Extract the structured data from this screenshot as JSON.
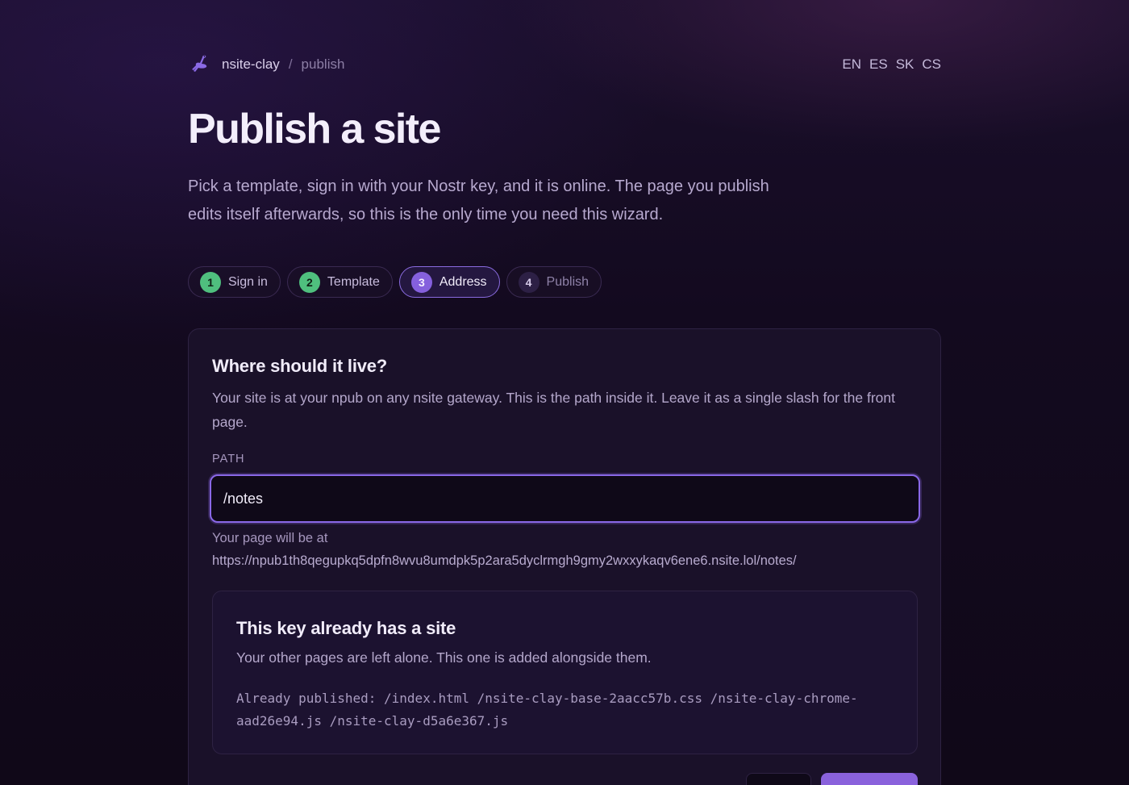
{
  "header": {
    "logo_icon": "ostrich-icon",
    "breadcrumb": {
      "home": "nsite-clay",
      "separator": "/",
      "current": "publish"
    },
    "languages": [
      "EN",
      "ES",
      "SK",
      "CS"
    ]
  },
  "page": {
    "title": "Publish a site",
    "lede": "Pick a template, sign in with your Nostr key, and it is online. The page you publish edits itself afterwards, so this is the only time you need this wizard."
  },
  "steps": [
    {
      "num": "1",
      "label": "Sign in",
      "state": "done"
    },
    {
      "num": "2",
      "label": "Template",
      "state": "done"
    },
    {
      "num": "3",
      "label": "Address",
      "state": "active"
    },
    {
      "num": "4",
      "label": "Publish",
      "state": "todo"
    }
  ],
  "address_card": {
    "heading": "Where should it live?",
    "description": "Your site is at your npub on any nsite gateway. This is the path inside it. Leave it as a single slash for the front page.",
    "path_label": "PATH",
    "path_value": "/notes",
    "hint": "Your page will be at",
    "url": "https://npub1th8qegupkq5dpfn8wvu8umdpk5p2ara5dyclrmgh9gmy2wxxykaqv6ene6.nsite.lol/notes/"
  },
  "existing_site": {
    "heading": "This key already has a site",
    "sub": "Your other pages are left alone. This one is added alongside them.",
    "files_text": "Already published: /index.html /nsite-clay-base-2aacc57b.css /nsite-clay-chrome-aad26e94.js /nsite-clay-d5a6e367.js"
  },
  "colors": {
    "accent": "#8a68e8",
    "done_green": "#4fbf7e",
    "background": "#120a1d"
  }
}
